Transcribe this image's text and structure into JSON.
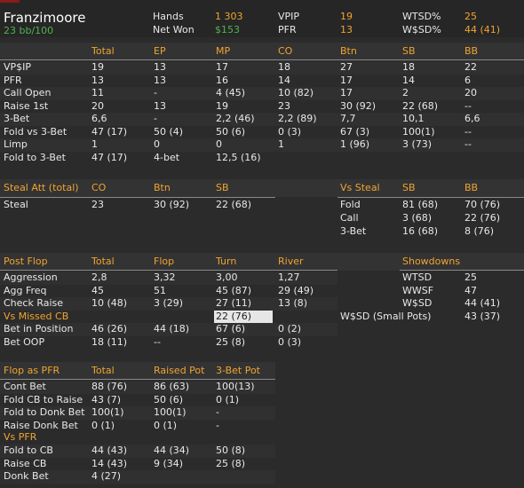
{
  "player": {
    "name": "Franzimoore",
    "sub": "23 bb/100"
  },
  "summary": [
    {
      "label": "Hands",
      "value": "1 303"
    },
    {
      "label": "Net Won",
      "value": "$153"
    },
    {
      "label": "VPIP",
      "value": "19"
    },
    {
      "label": "PFR",
      "value": "13"
    },
    {
      "label": "WTSD%",
      "value": "25"
    },
    {
      "label": "W$SD%",
      "value": "44 (41)"
    }
  ],
  "preflop": {
    "headers": [
      "Total",
      "EP",
      "MP",
      "CO",
      "Btn",
      "SB",
      "BB"
    ],
    "rows": [
      {
        "label": "VP$IP",
        "cells": [
          "19",
          "13",
          "17",
          "18",
          "27",
          "18",
          "22"
        ]
      },
      {
        "label": "PFR",
        "cells": [
          "13",
          "13",
          "16",
          "14",
          "17",
          "14",
          "6"
        ]
      },
      {
        "label": "Call Open",
        "cells": [
          "11",
          "-",
          "4 (45)",
          "10 (82)",
          "17",
          "2",
          "20"
        ]
      },
      {
        "label": "Raise 1st",
        "cells": [
          "20",
          "13",
          "19",
          "23",
          "30 (92)",
          "22 (68)",
          "--"
        ]
      },
      {
        "label": "3-Bet",
        "cells": [
          "6,6",
          "-",
          "2,2 (46)",
          "2,2 (89)",
          "7,7",
          "10,1",
          "6,6"
        ]
      },
      {
        "label": "Fold vs 3-Bet",
        "cells": [
          "47 (17)",
          "50 (4)",
          "50 (6)",
          "0 (3)",
          "67 (3)",
          "100(1)",
          "--"
        ]
      },
      {
        "label": "Limp",
        "cells": [
          "1",
          "0",
          "0",
          "1",
          "1 (96)",
          "3 (73)",
          "--"
        ]
      },
      {
        "label": "Fold to 3-Bet",
        "cells": [
          "47 (17)",
          "4-bet",
          "12,5 (16)",
          "",
          "",
          "",
          ""
        ]
      }
    ]
  },
  "steal": {
    "title": "Steal Att (total)",
    "headers": [
      "CO",
      "Btn",
      "SB"
    ],
    "row": {
      "label": "Steal",
      "cells": [
        "23",
        "30 (92)",
        "22 (68)"
      ]
    }
  },
  "vs_steal": {
    "title": "Vs Steal",
    "headers": [
      "SB",
      "BB"
    ],
    "rows": [
      {
        "label": "Fold",
        "cells": [
          "81 (68)",
          "70 (76)"
        ]
      },
      {
        "label": "Call",
        "cells": [
          "3 (68)",
          "22 (76)"
        ]
      },
      {
        "label": "3-Bet",
        "cells": [
          "16 (68)",
          "8 (76)"
        ]
      }
    ]
  },
  "postflop": {
    "title": "Post Flop",
    "headers": [
      "Total",
      "Flop",
      "Turn",
      "River"
    ],
    "rows": [
      {
        "label": "Aggression",
        "cells": [
          "2,8",
          "3,32",
          "3,00",
          "1,27"
        ]
      },
      {
        "label": "Agg Freq",
        "cells": [
          "45",
          "51",
          "45 (87)",
          "29 (49)"
        ]
      },
      {
        "label": "Check Raise",
        "cells": [
          "10 (48)",
          "3 (29)",
          "27 (11)",
          "13 (8)"
        ]
      },
      {
        "label": "Vs Missed CB",
        "cells": [
          "",
          "",
          "22 (76)",
          ""
        ]
      },
      {
        "label": "Bet in Position",
        "cells": [
          "46 (26)",
          "44 (18)",
          "67 (6)",
          "0 (2)"
        ]
      },
      {
        "label": "Bet OOP",
        "cells": [
          "18 (11)",
          "--",
          "25 (8)",
          "0 (3)"
        ]
      }
    ]
  },
  "showdowns": {
    "title": "Showdowns",
    "rows": [
      {
        "label": "WTSD",
        "value": "25"
      },
      {
        "label": "WWSF",
        "value": "47"
      },
      {
        "label": "W$SD",
        "value": "44 (41)"
      },
      {
        "label": "W$SD (Small Pots)",
        "value": "43 (37)"
      }
    ]
  },
  "flop_pfr": {
    "title": "Flop as PFR",
    "headers": [
      "Total",
      "Raised Pot",
      "3-Bet Pot"
    ],
    "rows": [
      {
        "label": "Cont Bet",
        "cells": [
          "88 (76)",
          "86 (63)",
          "100(13)"
        ]
      },
      {
        "label": "Fold CB to Raise",
        "cells": [
          "43 (7)",
          "50 (6)",
          "0 (1)"
        ]
      },
      {
        "label": "Fold to Donk Bet",
        "cells": [
          "100(1)",
          "100(1)",
          "-"
        ]
      },
      {
        "label": "Raise Donk Bet",
        "cells": [
          "0 (1)",
          "0 (1)",
          "-"
        ]
      }
    ],
    "vs_title": "Vs PFR",
    "vs_rows": [
      {
        "label": "Fold to CB",
        "cells": [
          "44 (43)",
          "44 (34)",
          "50 (8)"
        ]
      },
      {
        "label": "Raise CB",
        "cells": [
          "14 (43)",
          "9 (34)",
          "25 (8)"
        ]
      },
      {
        "label": "Donk Bet",
        "cells": [
          "4 (27)",
          "",
          ""
        ]
      }
    ]
  },
  "colors": {
    "accent": "#f0a431",
    "positive": "#4fb34f",
    "background": "#2b2b2b"
  }
}
